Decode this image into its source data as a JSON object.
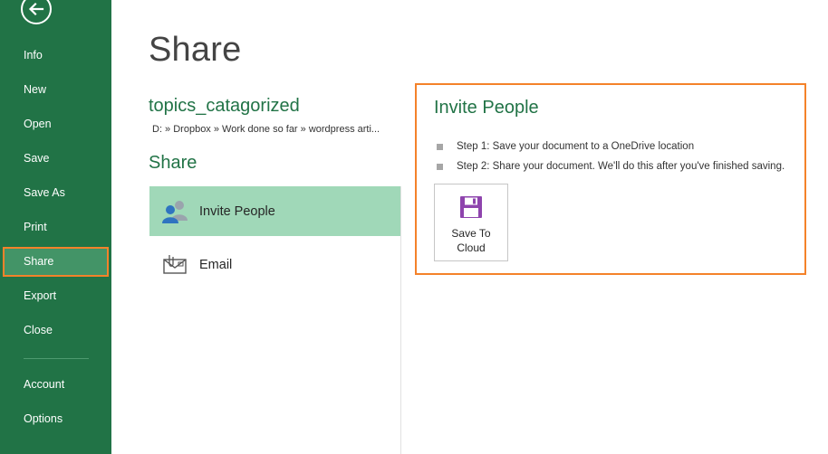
{
  "sidebar": {
    "items": [
      {
        "label": "Info"
      },
      {
        "label": "New"
      },
      {
        "label": "Open"
      },
      {
        "label": "Save"
      },
      {
        "label": "Save As"
      },
      {
        "label": "Print"
      },
      {
        "label": "Share"
      },
      {
        "label": "Export"
      },
      {
        "label": "Close"
      },
      {
        "label": "Account"
      },
      {
        "label": "Options"
      }
    ],
    "active": "Share"
  },
  "main": {
    "title": "Share",
    "doc_name": "topics_catagorized",
    "doc_path": "D: » Dropbox » Work done so far » wordpress arti...",
    "share_heading": "Share",
    "options": [
      {
        "label": "Invite People",
        "icon": "people-icon",
        "selected": true
      },
      {
        "label": "Email",
        "icon": "email-icon",
        "selected": false
      }
    ]
  },
  "panel": {
    "title": "Invite People",
    "steps": [
      "Step 1: Save your document to a OneDrive location",
      "Step 2: Share your document. We'll do this after you've finished saving."
    ],
    "save_button": {
      "line1": "Save To",
      "line2": "Cloud",
      "icon": "save-disk-icon"
    }
  },
  "colors": {
    "sidebar_bg": "#217346",
    "accent_green": "#217346",
    "highlight_orange": "#f4822a",
    "selected_option": "#a0d8b8",
    "save_icon": "#8e44ad"
  }
}
